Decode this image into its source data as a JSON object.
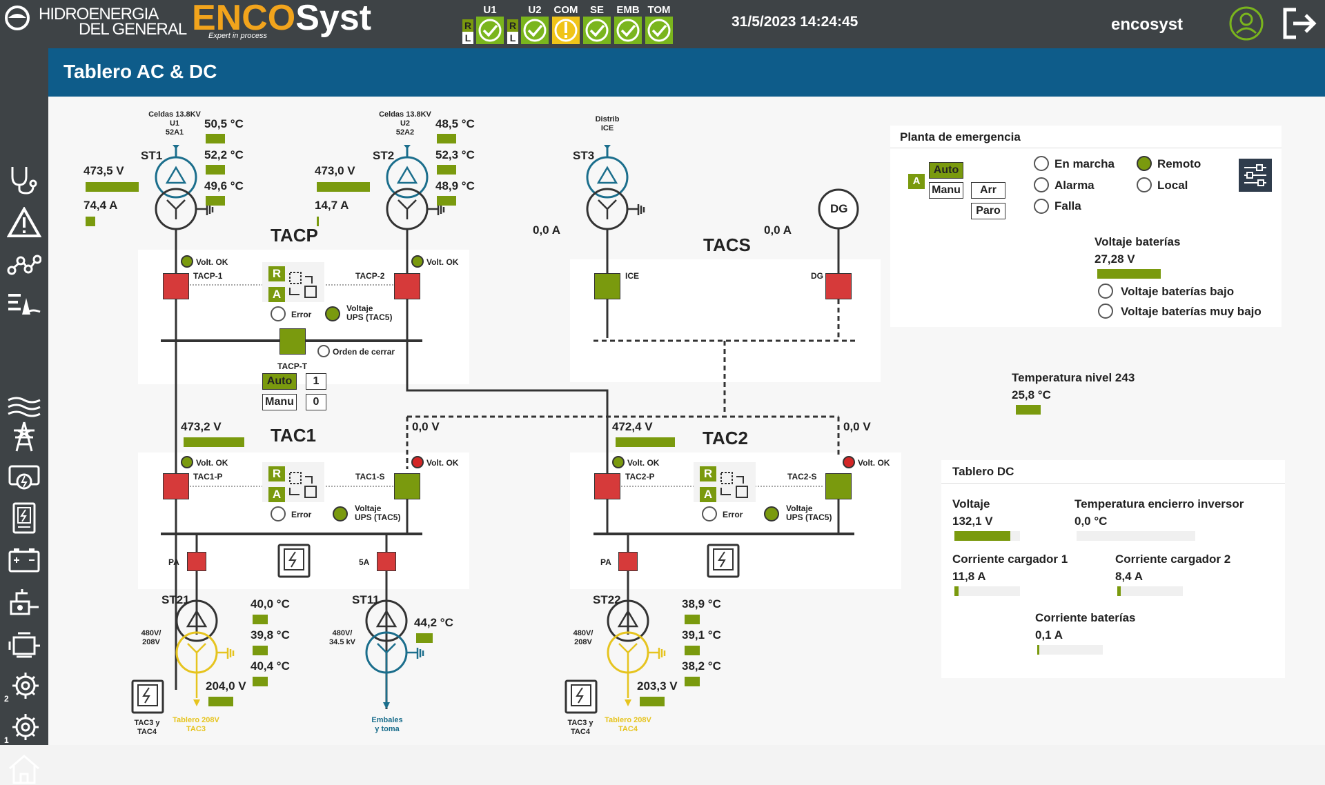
{
  "header": {
    "company_line1": "HIDROENERGIA",
    "company_line2": "DEL GENERAL",
    "brand_enco": "ENCO",
    "brand_syst": "Syst",
    "brand_tagline": "Expert in process",
    "datetime": "31/5/2023 14:24:45",
    "username": "encosyst",
    "status": [
      {
        "label": "U1",
        "rl": true
      },
      {
        "label": "U2",
        "rl": true
      },
      {
        "label": "COM",
        "warn": true
      },
      {
        "label": "SE"
      },
      {
        "label": "EMB"
      },
      {
        "label": "TOM"
      }
    ],
    "r_letter": "R",
    "l_letter": "L"
  },
  "page": {
    "title": "Tablero AC & DC"
  },
  "sidebar": {
    "items": [
      "stethoscope-icon",
      "alert-icon",
      "network-icon",
      "level-icon",
      "water-icon",
      "tower-icon",
      "generator-icon",
      "panel-icon",
      "battery-icon",
      "pump-icon",
      "motor-icon",
      "gear2-icon",
      "gear1-icon",
      "home-icon"
    ],
    "gear2_num": "2",
    "gear1_num": "1"
  },
  "tacp": {
    "title": "TACP",
    "st1": {
      "name": "ST1",
      "src": "Celdas 13.8KV",
      "src2": "U1",
      "src3": "52A1",
      "t1": "50,5 °C",
      "t2": "52,2 °C",
      "t3": "49,6 °C",
      "volt": "473,5 V",
      "curr": "74,4 A",
      "volt_pct": 0.85,
      "curr_pct": 0.15
    },
    "st2": {
      "name": "ST2",
      "src": "Celdas 13.8KV",
      "src2": "U2",
      "src3": "52A2",
      "t1": "48,5 °C",
      "t2": "52,3 °C",
      "t3": "48,9 °C",
      "volt": "473,0 V",
      "curr": "14,7 A",
      "volt_pct": 0.85,
      "curr_pct": 0.03
    },
    "volt_ok1": "Volt. OK",
    "volt_ok2": "Volt. OK",
    "brk1": "TACP-1",
    "brk2": "TACP-2",
    "brkt": "TACP-T",
    "r": "R",
    "a": "A",
    "error": "Error",
    "ups": "Voltaje",
    "ups2": "UPS (TAC5)",
    "orden": "Orden de cerrar",
    "auto": "Auto",
    "manu": "Manu",
    "auto_val": "1",
    "manu_val": "0"
  },
  "tacs": {
    "title": "TACS",
    "st3": "ST3",
    "src": "Distrib",
    "src2": "ICE",
    "curr1": "0,0 A",
    "curr2": "0,0 A",
    "dg": "DG",
    "brk_ice": "ICE",
    "brk_dg": "DG"
  },
  "tac1": {
    "title": "TAC1",
    "volt_l": "473,2 V",
    "volt_r": "0,0 V",
    "volt_ok1": "Volt. OK",
    "volt_ok2": "Volt. OK",
    "brk1": "TAC1-P",
    "brk2": "TAC1-S",
    "r": "R",
    "a": "A",
    "error": "Error",
    "ups": "Voltaje",
    "ups2": "UPS (TAC5)",
    "pa": "PA",
    "sa": "5A",
    "st21": {
      "name": "ST21",
      "ratio": "480V/",
      "ratio2": "208V",
      "t1": "40,0 °C",
      "t2": "39,8 °C",
      "t3": "40,4 °C",
      "volt": "204,0 V",
      "dest": "Tablero 208V",
      "dest2": "TAC3",
      "left": "TAC3 y",
      "left2": "TAC4"
    },
    "st11": {
      "name": "ST11",
      "ratio": "480V/",
      "ratio2": "34.5 kV",
      "t1": "44,2 °C",
      "dest": "Embales",
      "dest2": "y toma"
    }
  },
  "tac2": {
    "title": "TAC2",
    "volt_l": "472,4 V",
    "volt_r": "0,0 V",
    "volt_ok1": "Volt. OK",
    "volt_ok2": "Volt. OK",
    "brk1": "TAC2-P",
    "brk2": "TAC2-S",
    "r": "R",
    "a": "A",
    "error": "Error",
    "ups": "Voltaje",
    "ups2": "UPS (TAC5)",
    "pa": "PA",
    "st22": {
      "name": "ST22",
      "ratio": "480V/",
      "ratio2": "208V",
      "t1": "38,9 °C",
      "t2": "39,1 °C",
      "t3": "38,2 °C",
      "volt": "203,3 V",
      "dest": "Tablero 208V",
      "dest2": "TAC4",
      "left": "TAC3 y",
      "left2": "TAC4"
    }
  },
  "planta": {
    "title": "Planta de emergencia",
    "a": "A",
    "auto": "Auto",
    "manu": "Manu",
    "arr": "Arr",
    "paro": "Paro",
    "en_marcha": "En marcha",
    "alarma": "Alarma",
    "falla": "Falla",
    "remoto": "Remoto",
    "local": "Local",
    "volt_title": "Voltaje baterías",
    "volt_val": "27,28 V",
    "bajo": "Voltaje baterías bajo",
    "muy_bajo": "Voltaje baterías muy bajo"
  },
  "temp243": {
    "title": "Temperatura nivel 243",
    "val": "25,8 °C"
  },
  "dc": {
    "title": "Tablero DC",
    "voltaje": "Voltaje",
    "voltaje_val": "132,1 V",
    "voltaje_pct": 0.85,
    "temp": "Temperatura encierro inversor",
    "temp_val": "0,0 °C",
    "temp_pct": 0,
    "c1": "Corriente cargador 1",
    "c1_val": "11,8 A",
    "c1_pct": 0.06,
    "c2": "Corriente cargador 2",
    "c2_val": "8,4 A",
    "c2_pct": 0.05,
    "cb": "Corriente baterías",
    "cb_val": "0,1 A",
    "cb_pct": 0.01
  },
  "colors": {
    "accent_green": "#7a9a0e",
    "breaker_red": "#d63a3a",
    "header_bg": "#3e4346",
    "title_bg": "#0e5c8a",
    "yellow_208": "#e6c41f",
    "blue_345": "#1b6e8c"
  }
}
